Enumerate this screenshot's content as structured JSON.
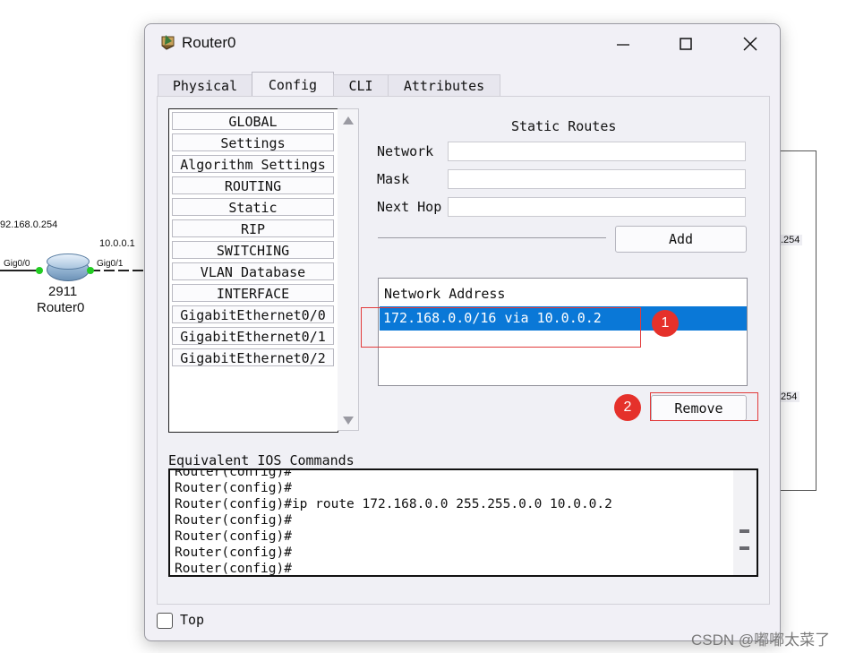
{
  "background": {
    "ip_left": "92.168.0.254",
    "ip_right": "10.0.0.1",
    "port_left": "Gig0/0",
    "port_right": "Gig0/1",
    "device_model": "2911",
    "device_name": "Router0",
    "edge_label_1": ".254",
    "edge_label_2": "254"
  },
  "window": {
    "title": "Router0",
    "minimize_icon": "minimize-icon",
    "maximize_icon": "maximize-icon",
    "close_icon": "close-icon"
  },
  "tabs": [
    {
      "label": "Physical",
      "active": false
    },
    {
      "label": "Config",
      "active": true
    },
    {
      "label": "CLI",
      "active": false
    },
    {
      "label": "Attributes",
      "active": false
    }
  ],
  "sidebar": {
    "items": [
      {
        "label": "GLOBAL"
      },
      {
        "label": "Settings"
      },
      {
        "label": "Algorithm Settings"
      },
      {
        "label": "ROUTING"
      },
      {
        "label": "Static"
      },
      {
        "label": "RIP"
      },
      {
        "label": "SWITCHING"
      },
      {
        "label": "VLAN Database"
      },
      {
        "label": "INTERFACE"
      },
      {
        "label": "GigabitEthernet0/0"
      },
      {
        "label": "GigabitEthernet0/1"
      },
      {
        "label": "GigabitEthernet0/2"
      }
    ]
  },
  "static_routes": {
    "title": "Static Routes",
    "network_label": "Network",
    "network_value": "",
    "mask_label": "Mask",
    "mask_value": "",
    "next_hop_label": "Next Hop",
    "next_hop_value": "",
    "add_label": "Add",
    "list_header": "Network Address",
    "routes": [
      "172.168.0.0/16 via 10.0.0.2"
    ],
    "remove_label": "Remove"
  },
  "annotations": {
    "badge_1": "1",
    "badge_2": "2",
    "color": "#e5312b"
  },
  "ios": {
    "label": "Equivalent IOS Commands",
    "lines": [
      "Router(config)#",
      "Router(config)#",
      "Router(config)#ip route 172.168.0.0 255.255.0.0 10.0.0.2",
      "Router(config)#",
      "Router(config)#",
      "Router(config)#",
      "Router(config)#"
    ]
  },
  "footer": {
    "top_label": "Top",
    "top_checked": false
  },
  "watermark": "CSDN @嘟嘟太菜了",
  "colors": {
    "selection": "#0a78d7",
    "highlight": "#e23b3b"
  }
}
